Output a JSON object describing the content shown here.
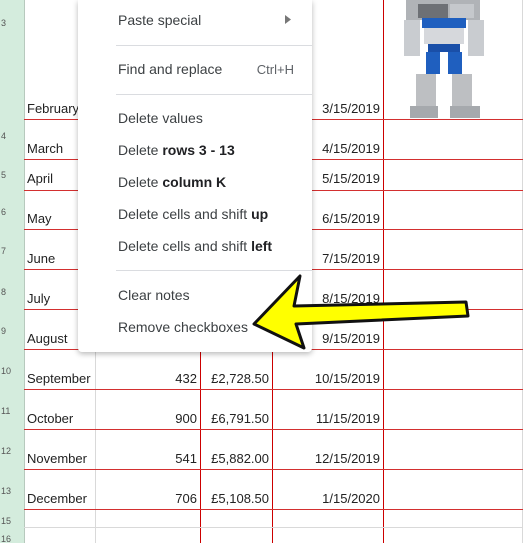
{
  "row_numbers": [
    "3",
    "4",
    "5",
    "6",
    "7",
    "8",
    "9",
    "10",
    "11",
    "12",
    "13",
    "15",
    "16"
  ],
  "months": [
    "February",
    "March",
    "April",
    "May",
    "June",
    "July",
    "August",
    "September",
    "October",
    "November",
    "December"
  ],
  "quantities": [
    "432",
    "900",
    "541",
    "706"
  ],
  "amounts": [
    "£2,728.50",
    "£6,791.50",
    "£5,882.00",
    "£5,108.50"
  ],
  "dates": [
    "3/15/2019",
    "4/15/2019",
    "5/15/2019",
    "6/15/2019",
    "7/15/2019",
    "8/15/2019",
    "9/15/2019",
    "10/15/2019",
    "11/15/2019",
    "12/15/2019",
    "1/15/2020"
  ],
  "menu": {
    "paste_special": "Paste special",
    "find_replace": "Find and replace",
    "find_replace_shortcut": "Ctrl+H",
    "delete_values": "Delete values",
    "delete_rows_prefix": "Delete ",
    "delete_rows_bold": "rows 3 - 13",
    "delete_column_prefix": "Delete ",
    "delete_column_bold": "column K",
    "delete_shift_up_prefix": "Delete cells and shift ",
    "delete_shift_up_bold": "up",
    "delete_shift_left_prefix": "Delete cells and shift ",
    "delete_shift_left_bold": "left",
    "clear_notes": "Clear notes",
    "remove_checkboxes": "Remove checkboxes"
  },
  "icons": {
    "submenu": "submenu-arrow-icon",
    "annotation": "yellow-arrow-icon",
    "image": "robot-image"
  },
  "colors": {
    "row_header": "#d4ecdd",
    "row_border": "#d32f2f",
    "arrow_fill": "#ffff00"
  }
}
